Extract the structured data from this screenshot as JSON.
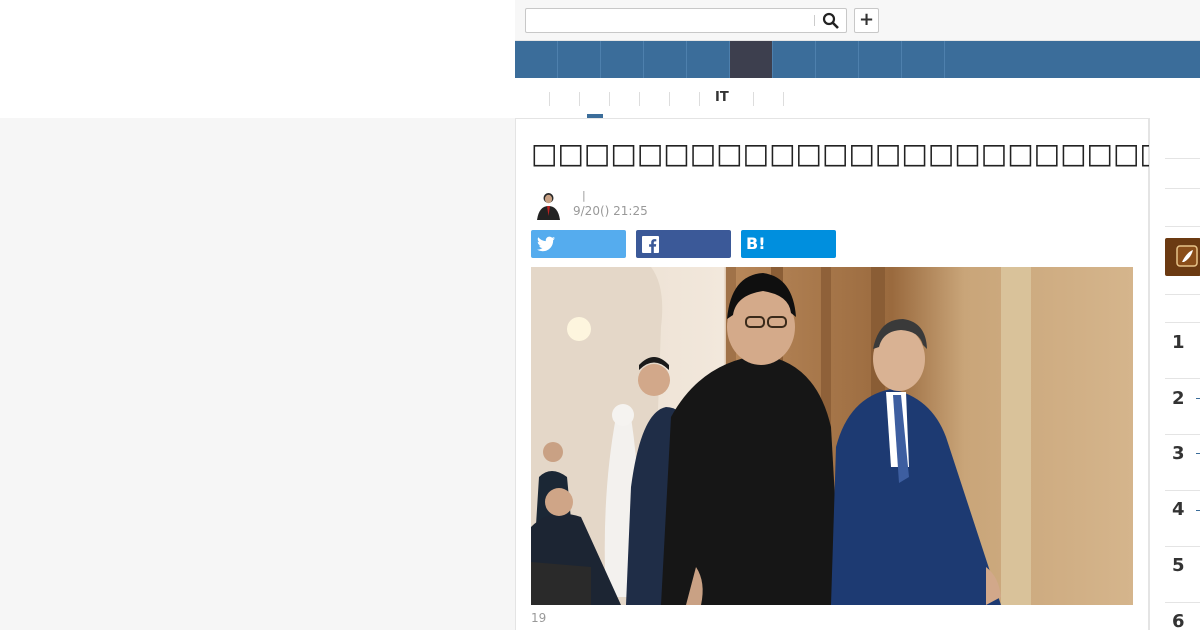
{
  "search": {
    "placeholder": "",
    "value": ""
  },
  "header": {
    "plus_label": "+"
  },
  "subnav": {
    "it_label": "IT"
  },
  "article": {
    "title": "□□□□□□□□□□□□□□□□□□□□□□□□□□",
    "byline_separator": "|",
    "date": "9/20() 21:25",
    "caption": "19"
  },
  "share": {
    "hatena_label": "B!"
  },
  "ranking": {
    "numbers": [
      "1",
      "2",
      "3",
      "4",
      "5",
      "6"
    ]
  },
  "colors": {
    "nav_bg": "#3b6d9a",
    "nav_active": "#3d3f4e",
    "twitter": "#55acee",
    "facebook": "#3b5998",
    "hatena": "#008fde"
  }
}
